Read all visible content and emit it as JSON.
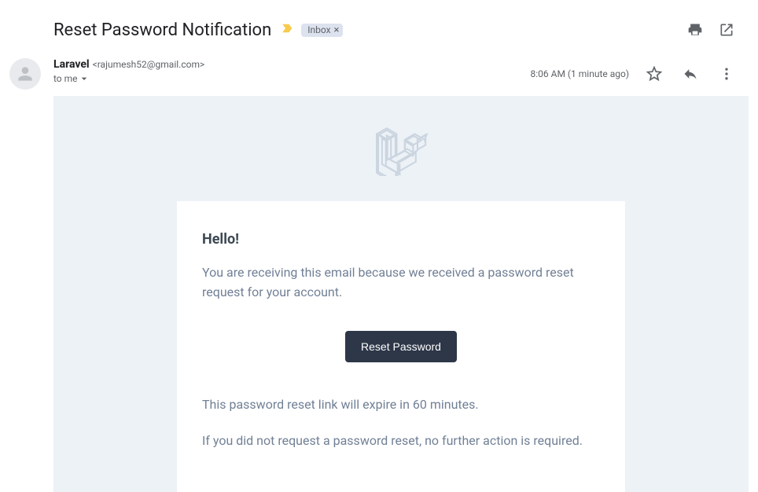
{
  "header": {
    "subject": "Reset Password Notification",
    "label": "Inbox"
  },
  "meta": {
    "sender_name": "Laravel",
    "sender_email": "<rajumesh52@gmail.com>",
    "to_text": "to me",
    "timestamp": "8:06 AM (1 minute ago)"
  },
  "email": {
    "greeting": "Hello!",
    "intro": "You are receiving this email because we received a password reset request for your account.",
    "cta_label": "Reset Password",
    "expire_text": "This password reset link will expire in 60 minutes.",
    "ignore_text": "If you did not request a password reset, no further action is required."
  }
}
